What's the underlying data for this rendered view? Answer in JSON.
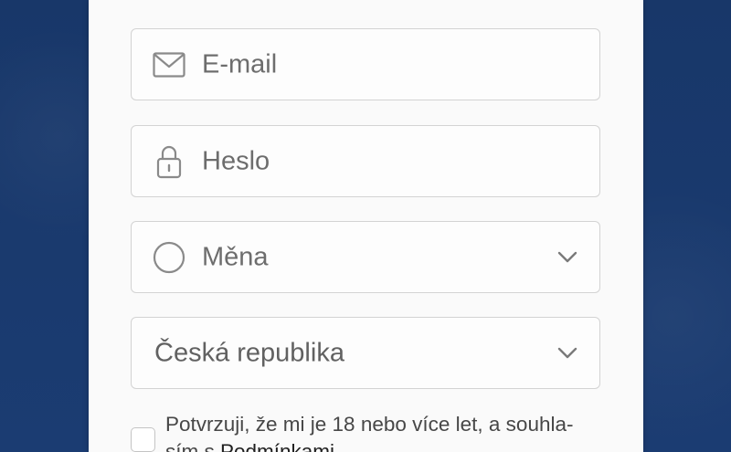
{
  "form": {
    "email": {
      "placeholder": "E-mail",
      "icon": "envelope-icon"
    },
    "password": {
      "placeholder": "Heslo",
      "icon": "lock-icon"
    },
    "currency": {
      "placeholder": "Měna",
      "icon": "circle-icon"
    },
    "country": {
      "selected": "Česká republika"
    },
    "consent": {
      "text_line1": "Potvrzuji, že mi je 18 nebo více let, a souhla-",
      "text_line2_prefix": "sím s ",
      "link_label": "Podmínkami",
      "checked": false
    }
  },
  "colors": {
    "background": "#1a3a6e",
    "panel": "#fafafa",
    "border": "#d3d3d3",
    "placeholder_text": "#6d6d6d"
  }
}
